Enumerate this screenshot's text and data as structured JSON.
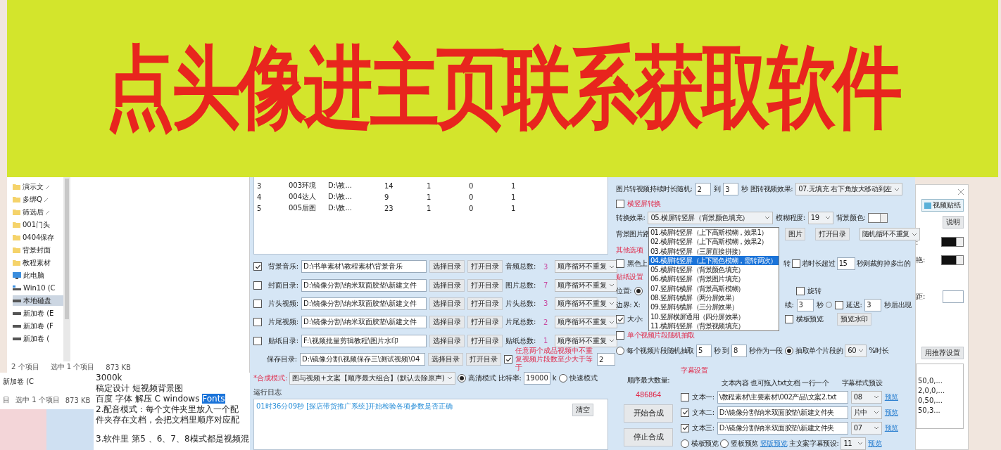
{
  "banner": {
    "text": "点头像进主页联系获取软件"
  },
  "explorer": {
    "nav_items": [
      {
        "label": "演示文",
        "kind": "pinned",
        "selected": false
      },
      {
        "label": "多绑Q",
        "kind": "pinned",
        "selected": false
      },
      {
        "label": "筛选后",
        "kind": "pinned",
        "selected": false
      },
      {
        "label": "001门头",
        "kind": "folder",
        "selected": false
      },
      {
        "label": "0404保存",
        "kind": "folder",
        "selected": false
      },
      {
        "label": "背景封面",
        "kind": "folder",
        "selected": false
      },
      {
        "label": "教程素材",
        "kind": "folder",
        "selected": false
      },
      {
        "label": "此电脑",
        "kind": "pc",
        "selected": false
      },
      {
        "label": "Win10 (C",
        "kind": "system",
        "selected": false
      },
      {
        "label": "本地磁盘",
        "kind": "drive",
        "selected": true
      },
      {
        "label": "新加卷 (E",
        "kind": "drive",
        "selected": false
      },
      {
        "label": "新加卷 (F",
        "kind": "drive",
        "selected": false
      },
      {
        "label": "新加卷 (",
        "kind": "drive",
        "selected": false
      }
    ],
    "status": [
      "2 个项目",
      "选中 1 个项目",
      "873 KB"
    ]
  },
  "back_explorer": {
    "nav_item": "新加卷 (C",
    "status": [
      "目",
      "选中 1 个项目",
      "873 KB"
    ]
  },
  "document": {
    "lines": [
      [
        {
          "text": "3000k",
          "highlighted": false
        }
      ],
      [
        {
          "text": "稿定设计  短视频背景图",
          "highlighted": false
        }
      ],
      [
        {
          "text": "百度 字体 解压 C windows ",
          "highlighted": false
        },
        {
          "text": "Fonts",
          "highlighted": true
        }
      ],
      [
        {
          "text": "2.配音模式：每个文件夹里放入一个配",
          "highlighted": false
        }
      ],
      [
        {
          "text": "件夹存在文档，会把文档里顺序对应配",
          "highlighted": false
        }
      ],
      [
        {
          "text": "3.软件里 第5 、6、7、8模式都是视频混",
          "highlighted": false
        }
      ]
    ]
  },
  "app": {
    "table": {
      "rows": [
        {
          "cells": [
            "3",
            "003环境",
            "D:\\教...",
            "14",
            "1",
            "0",
            "1"
          ]
        },
        {
          "cells": [
            "4",
            "004达人",
            "D:\\教...",
            "9",
            "1",
            "0",
            "1"
          ]
        },
        {
          "cells": [
            "5",
            "005后图",
            "D:\\教...",
            "23",
            "1",
            "0",
            "1"
          ]
        }
      ]
    },
    "dir_rows": [
      {
        "checked": true,
        "label": "背景音乐:",
        "path": "D:\\书单素材\\教程素材\\背景音乐",
        "select": "选择目录",
        "open": "打开目录",
        "count_label": "音频总数:",
        "count": "3",
        "order": "顺序循环不重复"
      },
      {
        "checked": false,
        "label": "封面目录:",
        "path": "D:\\镜像分割\\纳米双面胶垫\\新建文件",
        "select": "选择目录",
        "open": "打开目录",
        "count_label": "图片总数:",
        "count": "7",
        "order": "顺序循环不重复"
      },
      {
        "checked": false,
        "label": "片头视频:",
        "path": "D:\\镜像分割\\纳米双面胶垫\\新建文件",
        "select": "选择目录",
        "open": "打开目录",
        "count_label": "片头总数:",
        "count": "3",
        "order": "顺序循环不重复"
      },
      {
        "checked": false,
        "label": "片尾视频:",
        "path": "D:\\镜像分割\\纳米双面胶垫\\新建文件",
        "select": "选择目录",
        "open": "打开目录",
        "count_label": "片尾总数:",
        "count": "2",
        "order": "顺序循环不重复"
      },
      {
        "checked": false,
        "label": "贴纸目录:",
        "path": "F:\\视频批量剪辑教程\\图片水印",
        "select": "选择目录",
        "open": "打开目录",
        "count_label": "贴纸总数:",
        "count": "1",
        "order": "顺序循环不重复"
      }
    ],
    "save_row": {
      "label": "保存目录:",
      "path": "D:\\镜像分割\\视频保存三\\测试视频\\04",
      "select": "选择目录",
      "open": "打开目录",
      "checked": true,
      "note": "任意两个成品视频中不重复视频片段数至少大于等于",
      "value": "2"
    },
    "mode_row": {
      "label": "*合成模式:",
      "value": "图与视频+文案【顺序最大组合】(默认去除原声)",
      "hd": {
        "selected": true,
        "label": "高清模式"
      },
      "bitrate_label": "比特率:",
      "bitrate": "19000",
      "unit": "k",
      "fast": {
        "selected": false,
        "label": "快速模式"
      }
    },
    "log": {
      "title": "运行日志",
      "lines": [
        "01时36分09秒 [探店带货推广系统]开始检验各项参数是否正确"
      ],
      "clear": "清空"
    },
    "image_to_video": {
      "label": "图片转视频持续时长随机:",
      "from": "2",
      "to_label": "到",
      "to": "3",
      "unit": "秒 图转视频效果:",
      "effect": "07.无填充 右下角放大移动到左"
    },
    "orientation": {
      "checked": false,
      "label": "横竖屏转换",
      "effect_label": "转换效果:",
      "effect": "05.横屏转竖屏（背景颜色填充）",
      "blur_label": "模糊程度:",
      "blur": "19",
      "bg_color_label": "背景颜色:",
      "bg_path_label": "背景图片路",
      "image_button": "图片",
      "open_button": "打开目录",
      "order": "随机循环不重复"
    },
    "effect_list": {
      "items": [
        {
          "label": "01.横屏转竖屏（上下高斯模糊，效果1）",
          "selected": false
        },
        {
          "label": "02.横屏转竖屏（上下高斯模糊，效果2）",
          "selected": false
        },
        {
          "label": "03.横屏转竖屏（三屏直接拼接）",
          "selected": false
        },
        {
          "label": "04.横屏转竖屏（上下黑色模糊，需转两次）",
          "selected": true
        },
        {
          "label": "05.横屏转竖屏（背景颜色填充）",
          "selected": false
        },
        {
          "label": "06.横屏转竖屏（背景图片填充）",
          "selected": false
        },
        {
          "label": "07.竖屏转横屏（背景高斯模糊）",
          "selected": false
        },
        {
          "label": "08.竖屏转横屏（两分屏效果）",
          "selected": false
        },
        {
          "label": "09.竖屏转横屏（三分屏效果）",
          "selected": false
        },
        {
          "label": "10.竖屏横屏通用（四分屏效果）",
          "selected": false
        },
        {
          "label": "11.横屏转竖屏（背景视频填充）",
          "selected": false
        }
      ]
    },
    "other_options": {
      "title": "其他选项",
      "black_checked": false,
      "black_label": "黑色上",
      "rotate_tail": "转",
      "trim_checked": false,
      "trim_label": "若时长超过",
      "trim_value": "15",
      "trim_tail": "秒则裁剪掉多出的"
    },
    "sticker": {
      "title": "贴纸设置",
      "position_label": "位置:",
      "position_selected": true,
      "rotate_checked": false,
      "rotate_label": "旋转",
      "border_label": "边界: X:",
      "duration_label": "续:",
      "duration": "3",
      "duration_unit": "秒",
      "delay_checked": false,
      "delay_label": "延迟:",
      "delay": "3",
      "delay_tail": "秒后出现",
      "size_checked": true,
      "size_label": "大小:",
      "landscape_checked": false,
      "landscape_label": "横板预览",
      "preview_button": "预览水印"
    },
    "clip": {
      "checked": false,
      "title": "单个视频片段随机抽取",
      "each": {
        "selected": false,
        "label": "每个视频片段随机抽取"
      },
      "from": "5",
      "mid": "秒 到",
      "to": "8",
      "tail": "秒作为一段",
      "single": {
        "selected": true,
        "label": "抽取单个片段的"
      },
      "percent": "60",
      "percent_tail": "%时长"
    },
    "actions": {
      "max_label": "顺序最大数量:",
      "max_value": "486864",
      "start": "开始合成",
      "stop": "停止合成"
    },
    "subtitles": {
      "title": "字幕设置",
      "content_header": "文本内容 也可拖入txt文档 一行一个",
      "style_header": "字幕样式预设",
      "rows": [
        {
          "checked": false,
          "label": "文本一:",
          "path": "\\教程素材\\主要素材\\002产品\\文案2.txt",
          "style": "08",
          "link": "预览"
        },
        {
          "checked": true,
          "label": "文本二:",
          "path": "D:\\镜像分割\\纳米双面胶垫\\新建文件夹",
          "style": "片中",
          "link": "预览"
        },
        {
          "checked": true,
          "label": "文本三:",
          "path": "D:\\镜像分割\\纳米双面胶垫\\新建文件夹",
          "style": "07",
          "link": "预览"
        }
      ],
      "bottom": {
        "landscape": {
          "selected": false,
          "label": "横板预览"
        },
        "portrait": {
          "selected": false,
          "label": "竖板预览"
        },
        "link": "竖版预览",
        "preset_label": "主文案字幕预设:",
        "preset": "11",
        "preview": "预览"
      }
    }
  },
  "side_window": {
    "tab": "视频贴纸",
    "help": "说明",
    "color_rows": [
      {
        "label": ":"
      },
      {
        "label": "艳:"
      }
    ],
    "field_label": "距:",
    "recommend": "用推荐设置",
    "list": [
      "50,0,...",
      "2,0,0,...",
      "0,50,...",
      "50,3..."
    ]
  }
}
